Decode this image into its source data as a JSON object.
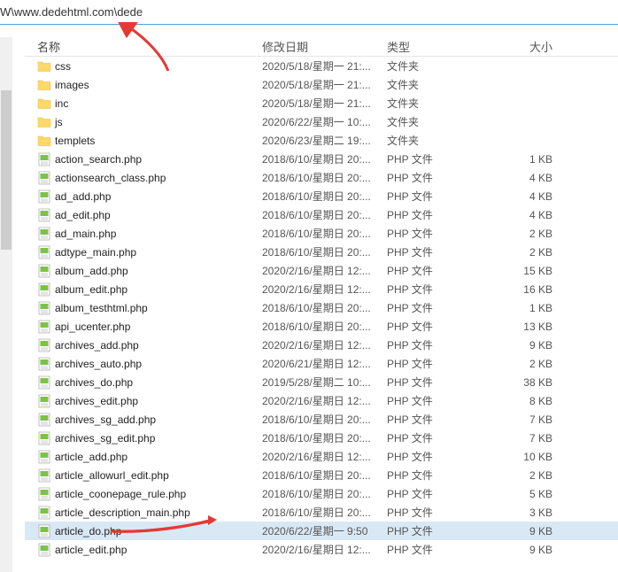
{
  "address": "W\\www.dedehtml.com\\dede",
  "columns": {
    "name": "名称",
    "date": "修改日期",
    "type": "类型",
    "size": "大小"
  },
  "rows": [
    {
      "icon": "folder",
      "name": "css",
      "date": "2020/5/18/星期一 21:...",
      "type": "文件夹",
      "size": ""
    },
    {
      "icon": "folder",
      "name": "images",
      "date": "2020/5/18/星期一 21:...",
      "type": "文件夹",
      "size": ""
    },
    {
      "icon": "folder",
      "name": "inc",
      "date": "2020/5/18/星期一 21:...",
      "type": "文件夹",
      "size": ""
    },
    {
      "icon": "folder",
      "name": "js",
      "date": "2020/6/22/星期一 10:...",
      "type": "文件夹",
      "size": ""
    },
    {
      "icon": "folder",
      "name": "templets",
      "date": "2020/6/23/星期二 19:...",
      "type": "文件夹",
      "size": ""
    },
    {
      "icon": "php",
      "name": "action_search.php",
      "date": "2018/6/10/星期日 20:...",
      "type": "PHP 文件",
      "size": "1 KB"
    },
    {
      "icon": "php",
      "name": "actionsearch_class.php",
      "date": "2018/6/10/星期日 20:...",
      "type": "PHP 文件",
      "size": "4 KB"
    },
    {
      "icon": "php",
      "name": "ad_add.php",
      "date": "2018/6/10/星期日 20:...",
      "type": "PHP 文件",
      "size": "4 KB"
    },
    {
      "icon": "php",
      "name": "ad_edit.php",
      "date": "2018/6/10/星期日 20:...",
      "type": "PHP 文件",
      "size": "4 KB"
    },
    {
      "icon": "php",
      "name": "ad_main.php",
      "date": "2018/6/10/星期日 20:...",
      "type": "PHP 文件",
      "size": "2 KB"
    },
    {
      "icon": "php",
      "name": "adtype_main.php",
      "date": "2018/6/10/星期日 20:...",
      "type": "PHP 文件",
      "size": "2 KB"
    },
    {
      "icon": "php",
      "name": "album_add.php",
      "date": "2020/2/16/星期日 12:...",
      "type": "PHP 文件",
      "size": "15 KB"
    },
    {
      "icon": "php",
      "name": "album_edit.php",
      "date": "2020/2/16/星期日 12:...",
      "type": "PHP 文件",
      "size": "16 KB"
    },
    {
      "icon": "php",
      "name": "album_testhtml.php",
      "date": "2018/6/10/星期日 20:...",
      "type": "PHP 文件",
      "size": "1 KB"
    },
    {
      "icon": "php",
      "name": "api_ucenter.php",
      "date": "2018/6/10/星期日 20:...",
      "type": "PHP 文件",
      "size": "13 KB"
    },
    {
      "icon": "php",
      "name": "archives_add.php",
      "date": "2020/2/16/星期日 12:...",
      "type": "PHP 文件",
      "size": "9 KB"
    },
    {
      "icon": "php",
      "name": "archives_auto.php",
      "date": "2020/6/21/星期日 12:...",
      "type": "PHP 文件",
      "size": "2 KB"
    },
    {
      "icon": "php",
      "name": "archives_do.php",
      "date": "2019/5/28/星期二 10:...",
      "type": "PHP 文件",
      "size": "38 KB"
    },
    {
      "icon": "php",
      "name": "archives_edit.php",
      "date": "2020/2/16/星期日 12:...",
      "type": "PHP 文件",
      "size": "8 KB"
    },
    {
      "icon": "php",
      "name": "archives_sg_add.php",
      "date": "2018/6/10/星期日 20:...",
      "type": "PHP 文件",
      "size": "7 KB"
    },
    {
      "icon": "php",
      "name": "archives_sg_edit.php",
      "date": "2018/6/10/星期日 20:...",
      "type": "PHP 文件",
      "size": "7 KB"
    },
    {
      "icon": "php",
      "name": "article_add.php",
      "date": "2020/2/16/星期日 12:...",
      "type": "PHP 文件",
      "size": "10 KB"
    },
    {
      "icon": "php",
      "name": "article_allowurl_edit.php",
      "date": "2018/6/10/星期日 20:...",
      "type": "PHP 文件",
      "size": "2 KB"
    },
    {
      "icon": "php",
      "name": "article_coonepage_rule.php",
      "date": "2018/6/10/星期日 20:...",
      "type": "PHP 文件",
      "size": "5 KB"
    },
    {
      "icon": "php",
      "name": "article_description_main.php",
      "date": "2018/6/10/星期日 20:...",
      "type": "PHP 文件",
      "size": "3 KB"
    },
    {
      "icon": "php",
      "name": "article_do.php",
      "date": "2020/6/22/星期一 9:50",
      "type": "PHP 文件",
      "size": "9 KB",
      "selected": true
    },
    {
      "icon": "php",
      "name": "article_edit.php",
      "date": "2020/2/16/星期日 12:...",
      "type": "PHP 文件",
      "size": "9 KB"
    }
  ]
}
